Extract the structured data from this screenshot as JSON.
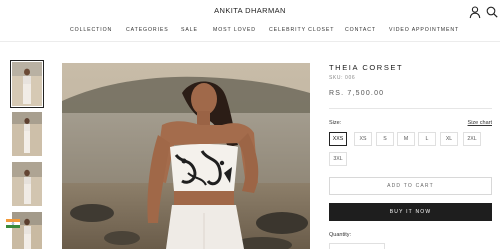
{
  "header": {
    "brand": "ANKITA DHARMAN",
    "nav": [
      "COLLECTION",
      "CATEGORIES",
      "SALE",
      "MOST LOVED",
      "CELEBRITY CLOSET",
      "CONTACT",
      "VIDEO APPOINTMENT"
    ],
    "icons": [
      "account-icon",
      "search-icon"
    ]
  },
  "gallery": {
    "thumbnail_count": 4,
    "active_index": 0
  },
  "product": {
    "title": "THEIA CORSET",
    "sku": "SKU: 006",
    "price": "RS. 7,500.00",
    "size_label": "Size:",
    "size_chart": "Size chart",
    "sizes": [
      "XXS",
      "XS",
      "S",
      "M",
      "L",
      "XL",
      "2XL",
      "3XL"
    ],
    "selected_size": "XXS",
    "add_to_cart": "ADD TO CART",
    "buy_now": "BUY IT NOW",
    "quantity_label": "Quantity:"
  }
}
